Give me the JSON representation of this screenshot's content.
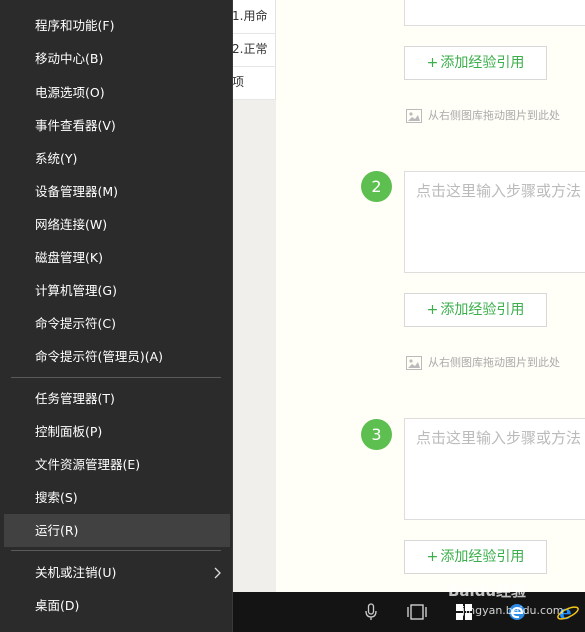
{
  "background_page": {
    "list_items": [
      "1.用命",
      "2.正常",
      "项"
    ],
    "step_placeholder": "点击这里输入步骤或方法",
    "add_reference_label": "添加经验引用",
    "add_reference_plus": "+",
    "image_hint": "从右侧图库拖动图片到此处",
    "steps": [
      "2",
      "3"
    ]
  },
  "menu": {
    "group1": [
      "程序和功能(F)",
      "移动中心(B)",
      "电源选项(O)",
      "事件查看器(V)",
      "系统(Y)",
      "设备管理器(M)",
      "网络连接(W)",
      "磁盘管理(K)",
      "计算机管理(G)",
      "命令提示符(C)",
      "命令提示符(管理员)(A)"
    ],
    "group2": [
      "任务管理器(T)",
      "控制面板(P)",
      "文件资源管理器(E)",
      "搜索(S)",
      "运行(R)"
    ],
    "group3": [
      "关机或注销(U)",
      "桌面(D)"
    ],
    "hovered_item": "运行(R)"
  },
  "taskbar": {
    "icons": [
      "microphone-icon",
      "task-view-icon",
      "windows-store-icon",
      "edge-icon",
      "ie-icon"
    ],
    "accent": "#0078d7"
  },
  "watermark": {
    "text": "Baidu经验",
    "sub": "jingyan.baidu.com"
  },
  "colors": {
    "step_green": "#5cbf4f",
    "button_text": "#3aaf4a",
    "menu_bg": "#2b2b2b"
  }
}
